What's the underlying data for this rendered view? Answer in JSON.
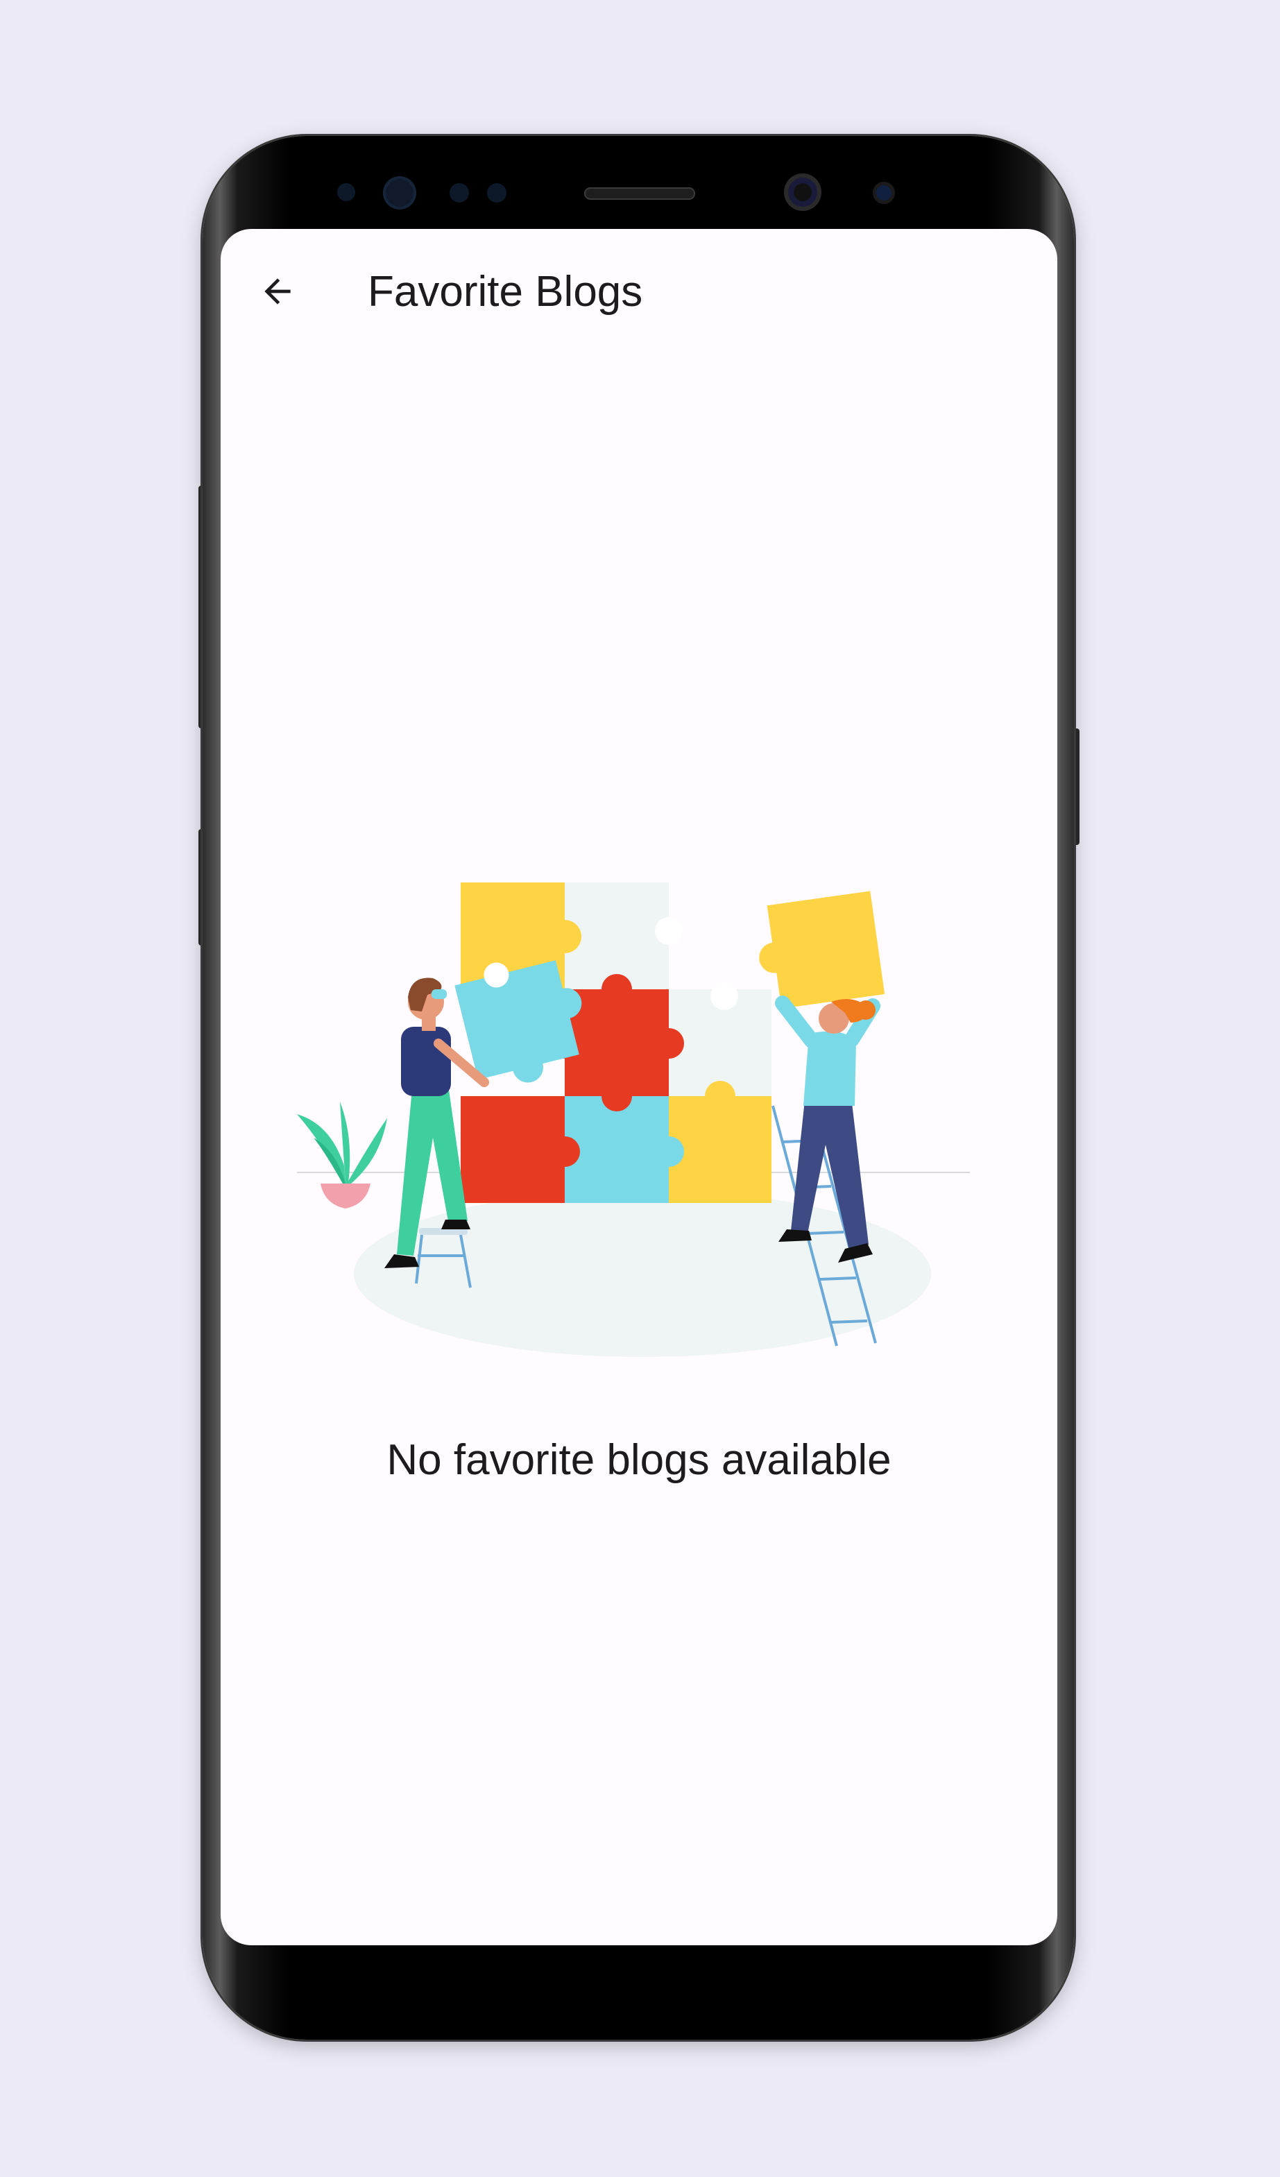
{
  "app_bar": {
    "title": "Favorite Blogs",
    "back_icon": "arrow-back-icon"
  },
  "empty_state": {
    "message": "No favorite blogs available",
    "illustration": "puzzle-assembly-illustration"
  },
  "colors": {
    "page_background": "#eceaf5",
    "screen_background": "#fffbfe",
    "text": "#1d1b20",
    "puzzle_yellow": "#fed344",
    "puzzle_red": "#e63a23",
    "puzzle_cyan": "#7ad9e6",
    "puzzle_light": "#eff4f4",
    "plant_green": "#3fcf9e",
    "pot_pink": "#f2a0ac",
    "pants_navy": "#3d4a84"
  }
}
